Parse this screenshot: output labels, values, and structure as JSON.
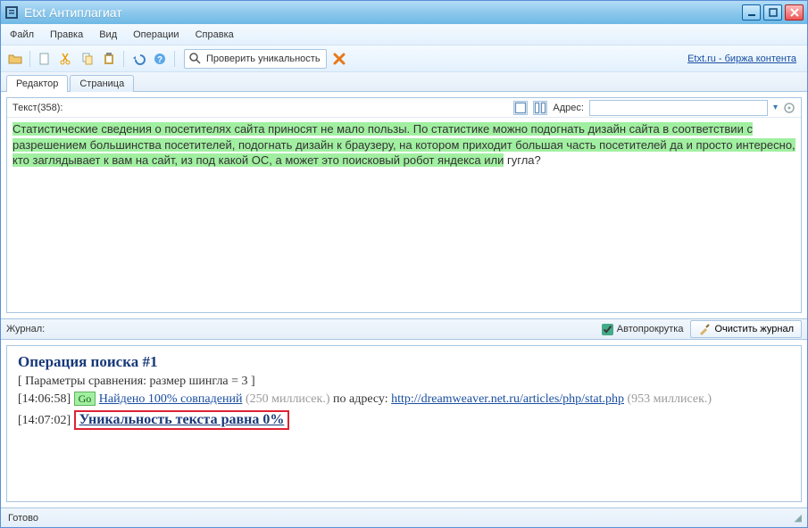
{
  "window": {
    "title": "Etxt Антиплагиат"
  },
  "menu": {
    "file": "Файл",
    "edit": "Правка",
    "view": "Вид",
    "operations": "Операции",
    "help": "Справка"
  },
  "toolbar": {
    "check_label": "Проверить уникальность",
    "link": "Etxt.ru - биржа контента"
  },
  "tabs": {
    "editor": "Редактор",
    "page": "Страница"
  },
  "editor": {
    "text_label": "Текст(358):",
    "address_label": "Адрес:",
    "address_value": "",
    "content_hl": "Статистические сведения о посетителях сайта приносят не мало пользы. По статистике можно подогнать дизайн сайта в соответствии с разрешением большинства посетителей, подогнать дизайн к браузеру, на котором приходит большая часть посетителей да и просто интересно, кто заглядывает к вам на сайт, из под какой ОС, а может это поисковый робот яндекса или",
    "content_tail": "гугла?"
  },
  "log": {
    "label": "Журнал:",
    "autoscroll": "Автопрокрутка",
    "clear": "Очистить журнал",
    "op_title": "Операция поиска #1",
    "params": "[ Параметры сравнения: размер шингла = 3 ]",
    "line1": {
      "ts": "[14:06:58]",
      "go": "Go",
      "found": "Найдено 100% совпадений",
      "time1": "(250 миллисек.)",
      "by": "по адресу:",
      "url": "http://dreamweaver.net.ru/articles/php/stat.php",
      "time2": "(953 миллисек.)"
    },
    "line2": {
      "ts": "[14:07:02]",
      "uniq": "Уникальность текста равна 0%"
    }
  },
  "status": {
    "text": "Готово"
  }
}
